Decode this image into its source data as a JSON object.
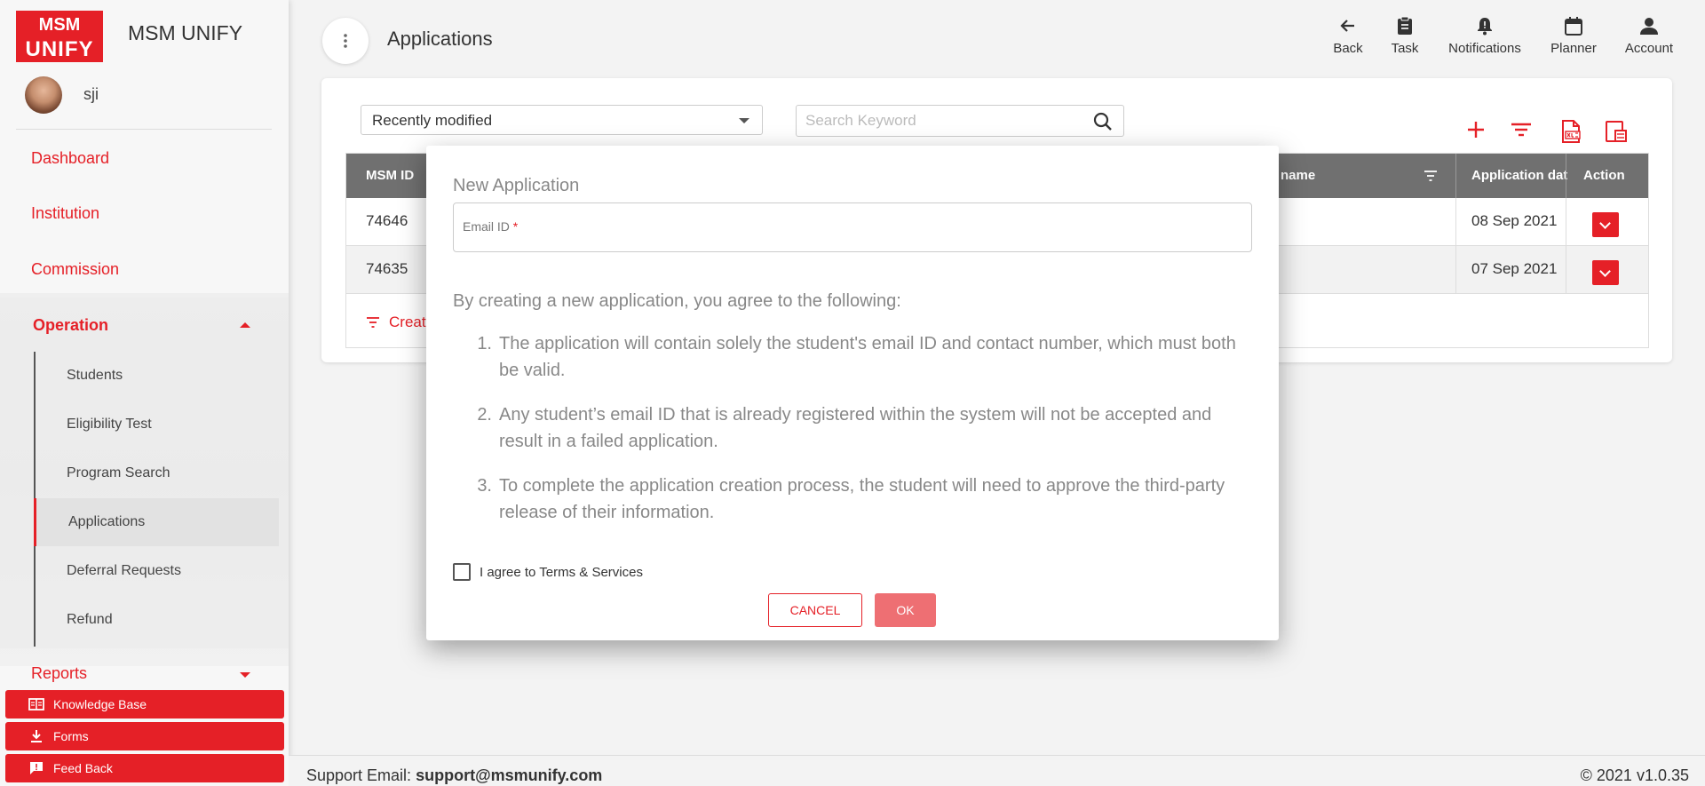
{
  "app": {
    "logo_top": "MSM",
    "logo_bottom": "UNIFY",
    "brand": "MSM UNIFY",
    "username": "sji"
  },
  "sidebar": {
    "items": [
      {
        "label": "Dashboard"
      },
      {
        "label": "Institution"
      },
      {
        "label": "Commission"
      }
    ],
    "operation": {
      "label": "Operation",
      "sub_items": [
        {
          "label": "Students"
        },
        {
          "label": "Eligibility Test"
        },
        {
          "label": "Program Search"
        },
        {
          "label": "Applications"
        },
        {
          "label": "Deferral Requests"
        },
        {
          "label": "Refund"
        }
      ]
    },
    "reports_label": "Reports",
    "buttons": [
      {
        "label": "Knowledge Base",
        "icon": "book-icon"
      },
      {
        "label": "Forms",
        "icon": "download-icon"
      },
      {
        "label": "Feed Back",
        "icon": "feedback-icon"
      }
    ]
  },
  "header": {
    "title": "Applications",
    "actions": [
      {
        "label": "Back",
        "icon": "arrow-left-icon"
      },
      {
        "label": "Task",
        "icon": "clipboard-icon"
      },
      {
        "label": "Notifications",
        "icon": "bell-icon"
      },
      {
        "label": "Planner",
        "icon": "calendar-icon"
      },
      {
        "label": "Account",
        "icon": "person-icon"
      }
    ]
  },
  "filters": {
    "sort_value": "Recently modified",
    "search_placeholder": "Search Keyword"
  },
  "table": {
    "headers": {
      "msm_id": "MSM ID",
      "name": "name",
      "app_date": "Application date",
      "action": "Action"
    },
    "rows": [
      {
        "msm_id": "74646",
        "app_date": "08 Sep 2021"
      },
      {
        "msm_id": "74635",
        "app_date": "07 Sep 2021"
      }
    ],
    "create_link": "Creat"
  },
  "modal": {
    "title": "New Application",
    "email_label": "Email ID",
    "required_mark": "*",
    "agree_text": "By creating a new application, you agree to the following:",
    "terms": [
      {
        "num": "1.",
        "text": "The application will contain solely the student's email ID and contact number, which must both be valid."
      },
      {
        "num": "2.",
        "text": "Any student’s email ID that is already registered within the system will not be accepted and result in a failed application."
      },
      {
        "num": "3.",
        "text": "To complete the application creation process, the student will need to approve the third-party release of their information."
      }
    ],
    "checkbox_label": "I agree to Terms & Services",
    "cancel_label": "CANCEL",
    "ok_label": "OK"
  },
  "footer": {
    "support_prefix": "Support Email:",
    "support_email": "support@msmunify.com",
    "copyright": "© 2021 v1.0.35"
  },
  "colors": {
    "accent": "#e52027",
    "ok_button": "#ee6f73",
    "table_header": "#707070"
  }
}
